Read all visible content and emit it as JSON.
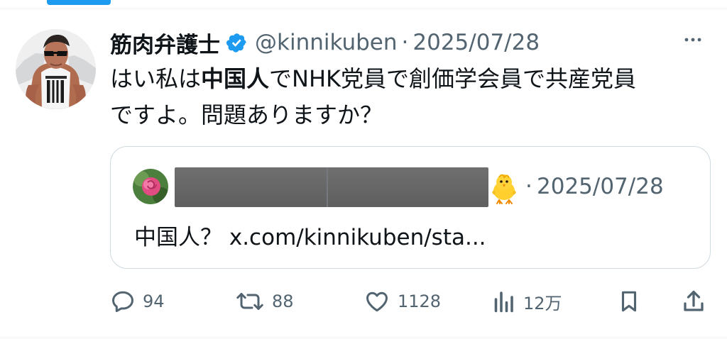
{
  "tweet": {
    "author": {
      "display_name": "筋肉弁護士",
      "handle": "@kinnikuben",
      "verified_icon": "verified-badge-icon"
    },
    "separator": "·",
    "date": "2025/07/28",
    "text_prefix": "はい私は",
    "text_bold": "中国人",
    "text_suffix": "でNHK党員で創価学会員で共産党員\nですよ。問題ありますか？",
    "more_icon": "more-horizontal-icon"
  },
  "quote": {
    "author_name_redacted": "",
    "emoji": "chick-emoji",
    "separator": "·",
    "date": "2025/07/28",
    "text": "中国人？ x.com/kinnikuben/sta..."
  },
  "actions": {
    "reply_count": "94",
    "retweet_count": "88",
    "like_count": "1128",
    "views_count": "12万"
  },
  "colors": {
    "accent": "#1d9bf0",
    "text": "#0f1419",
    "secondary": "#536471",
    "border": "#cfd9de"
  }
}
